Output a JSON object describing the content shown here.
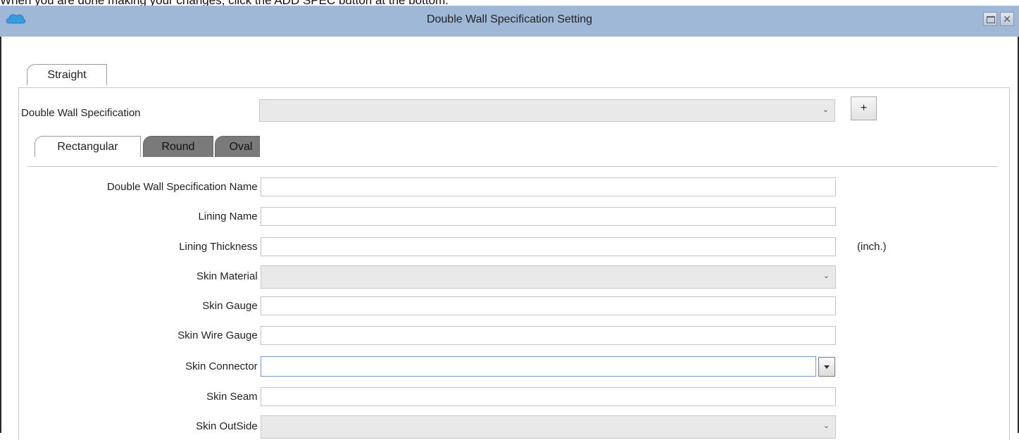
{
  "instruction": "When you are done making your changes, click the ADD SPEC button at the bottom.",
  "window": {
    "title": "Double Wall Specification Setting",
    "maximize_icon": "maximize-icon",
    "close_label": "✕"
  },
  "outer_tabs": [
    {
      "label": "Straight",
      "active": true
    }
  ],
  "spec_selector": {
    "label": "Double Wall Specification",
    "value": "",
    "add_label": "+"
  },
  "shape_tabs": [
    {
      "label": "Rectangular",
      "active": true
    },
    {
      "label": "Round",
      "active": false
    },
    {
      "label": "Oval",
      "active": false
    }
  ],
  "form": {
    "spec_name": {
      "label": "Double Wall Specification Name :",
      "value": ""
    },
    "lining_name": {
      "label": "Lining Name :",
      "value": ""
    },
    "lining_thickness": {
      "label": "Lining Thickness :",
      "value": "",
      "unit": "(inch.)"
    },
    "skin_material": {
      "label": "Skin Material :",
      "value": ""
    },
    "skin_gauge": {
      "label": "Skin Gauge :",
      "value": ""
    },
    "skin_wire_gauge": {
      "label": "Skin Wire Gauge :",
      "value": ""
    },
    "skin_connector": {
      "label": "Skin Connector :",
      "value": ""
    },
    "skin_seam": {
      "label": "Skin Seam :",
      "value": ""
    },
    "skin_outside": {
      "label": "Skin OutSide :",
      "value": ""
    }
  },
  "colors": {
    "titlebar": "#9fb8d7",
    "inactive_tab": "#7a7a7a"
  }
}
